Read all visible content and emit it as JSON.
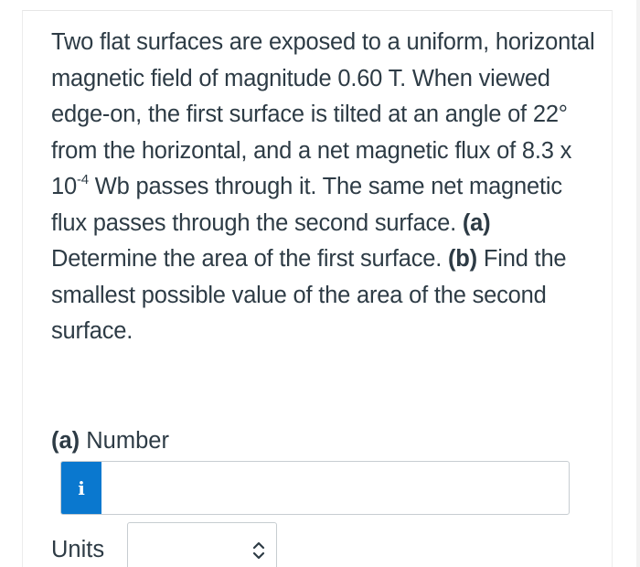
{
  "question": {
    "part1": "Two flat surfaces are exposed to a uniform, horizontal magnetic field of magnitude 0.60 T. When viewed edge-on, the first surface is tilted at an angle of 22° from the horizontal, and a net magnetic flux of 8.3 x 10",
    "exponent": "-4",
    "part2": " Wb passes through it. The same net magnetic flux passes through the second surface. ",
    "part_a_marker": "(a)",
    "part_a_text": " Determine the area of the first surface. ",
    "part_b_marker": "(b)",
    "part_b_text": " Find the smallest possible value of the area of the second surface."
  },
  "answer_a": {
    "marker": "(a)",
    "label": " Number",
    "info_icon": "i",
    "number_value": "",
    "units_label": "Units",
    "units_value": ""
  },
  "icons": {
    "info": "info-icon",
    "chevron": "chevron-up-down-icon"
  },
  "colors": {
    "info_button": "#0a78cf",
    "text": "#2d3b45",
    "border": "#c7cdd1"
  }
}
